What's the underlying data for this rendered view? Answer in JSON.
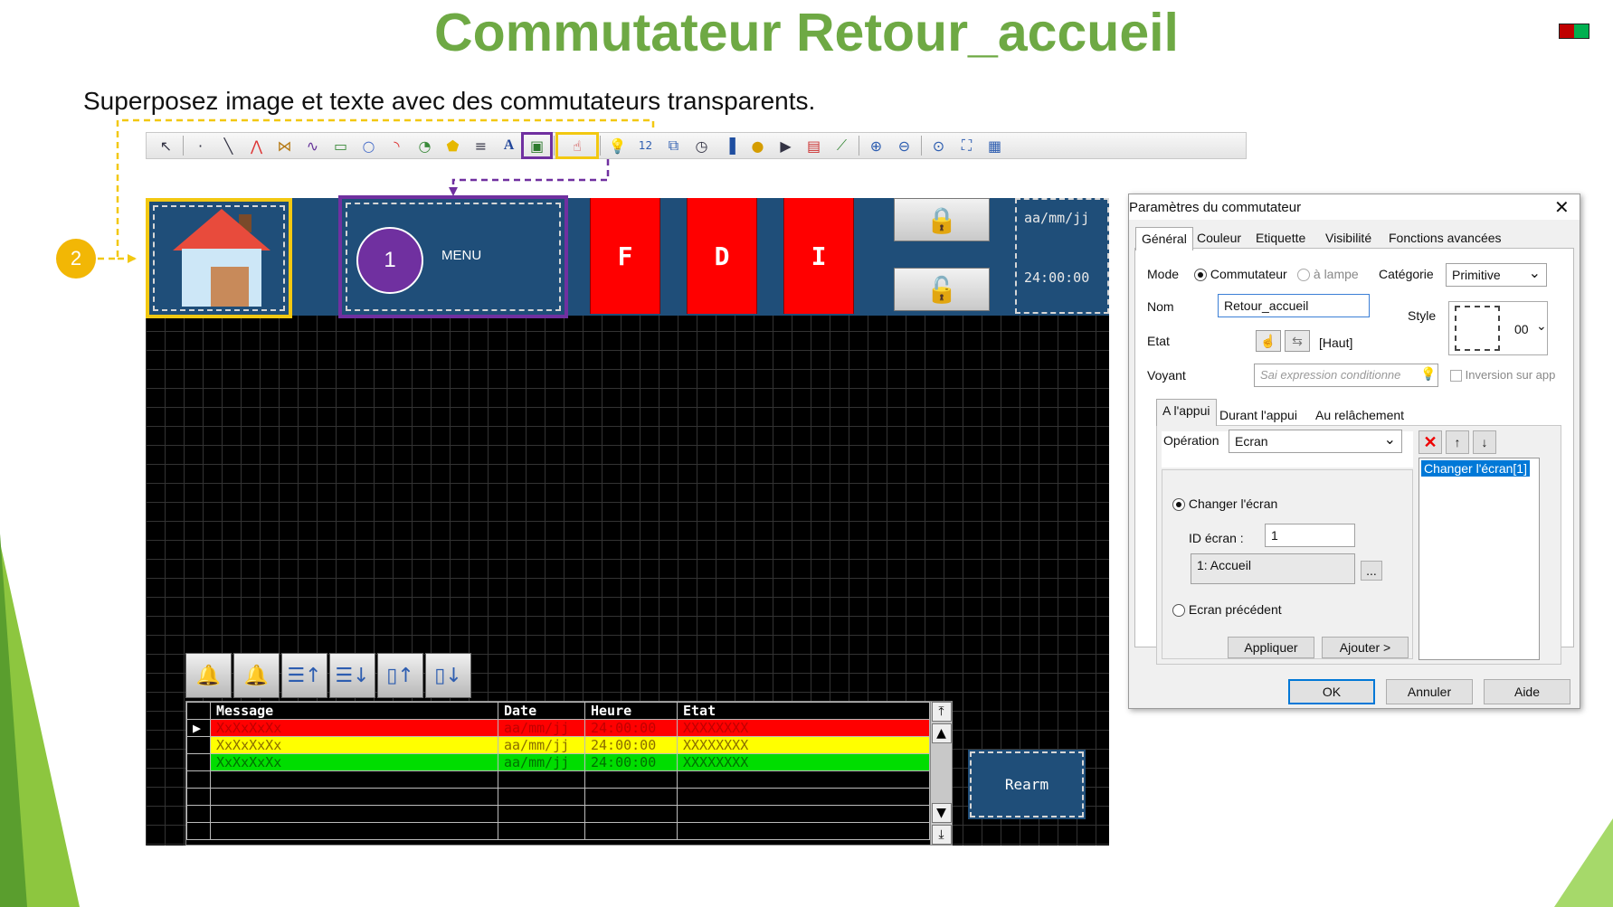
{
  "slide": {
    "title": "Commutateur Retour_accueil",
    "subtitle": "Superposez image et texte avec des commutateurs transparents.",
    "flag_colors": [
      "#c00000",
      "#00b050"
    ]
  },
  "callouts": {
    "marker_2": "2",
    "marker_1": "1",
    "marker_2_color": "#f2b705",
    "marker_1_color": "#7030a0"
  },
  "toolbar": {
    "icons": [
      "arrow-select-icon",
      "dot-icon",
      "line-icon",
      "polyline-icon",
      "freeform-icon",
      "curve-icon",
      "rectangle-icon",
      "circle-icon",
      "arc-icon",
      "pie-icon",
      "polygon-icon",
      "list-icon",
      "text-icon",
      "picture-icon",
      "switch-icon",
      "lamp-icon",
      "numeric-icon",
      "window-icon",
      "gauge-icon",
      "bar-graph-icon",
      "clock-icon",
      "camera-icon",
      "recipe-icon",
      "trend-icon",
      "zoom-fit-icon",
      "zoom-in-icon",
      "zoom-out-icon",
      "fit-screen-icon",
      "grid-icon"
    ]
  },
  "hmi": {
    "menu_label": "MENU",
    "fkeys": [
      "F",
      "D",
      "I"
    ],
    "date_text": "aa/mm/jj",
    "time_text": "24:00:00",
    "rearm_label": "Rearm",
    "alarm_table": {
      "headers": [
        "Message",
        "Date",
        "Heure",
        "Etat"
      ],
      "rows": [
        {
          "message": "XxXxXxXx",
          "date": "aa/mm/jj",
          "time": "24:00:00",
          "state": "XXXXXXXX",
          "bg": "#ff0000",
          "fg": "#c00000"
        },
        {
          "message": "XxXxXxXx",
          "date": "aa/mm/jj",
          "time": "24:00:00",
          "state": "XXXXXXXX",
          "bg": "#ffff00",
          "fg": "#8a6d00"
        },
        {
          "message": "XxXxXxXx",
          "date": "aa/mm/jj",
          "time": "24:00:00",
          "state": "XXXXXXXX",
          "bg": "#00dd00",
          "fg": "#007000"
        }
      ]
    }
  },
  "dialog": {
    "title": "Paramètres du commutateur",
    "tabs": [
      "Général",
      "Couleur",
      "Etiquette",
      "Visibilité",
      "Fonctions avancées"
    ],
    "mode_label": "Mode",
    "mode_commutateur": "Commutateur",
    "mode_lampe": "à lampe",
    "categorie_label": "Catégorie",
    "categorie_value": "Primitive",
    "nom_label": "Nom",
    "nom_value": "Retour_accueil",
    "style_label": "Style",
    "style_value": "00",
    "etat_label": "Etat",
    "etat_value": "[Haut]",
    "voyant_label": "Voyant",
    "voyant_placeholder": "Sai expression conditionne",
    "inversion_label": "Inversion sur app",
    "subtabs": [
      "A l'appui",
      "Durant l'appui",
      "Au relâchement"
    ],
    "operation_label": "Opération",
    "operation_value": "Ecran",
    "changer_ecran_label": "Changer l'écran",
    "id_ecran_label": "ID écran :",
    "id_ecran_value": "1",
    "ecran_name": "1: Accueil",
    "browse_label": "...",
    "ecran_precedent_label": "Ecran précédent",
    "appliquer_label": "Appliquer",
    "ajouter_label": "Ajouter >",
    "action_list": [
      "Changer l'écran[1]"
    ],
    "ok_label": "OK",
    "annuler_label": "Annuler",
    "aide_label": "Aide"
  }
}
